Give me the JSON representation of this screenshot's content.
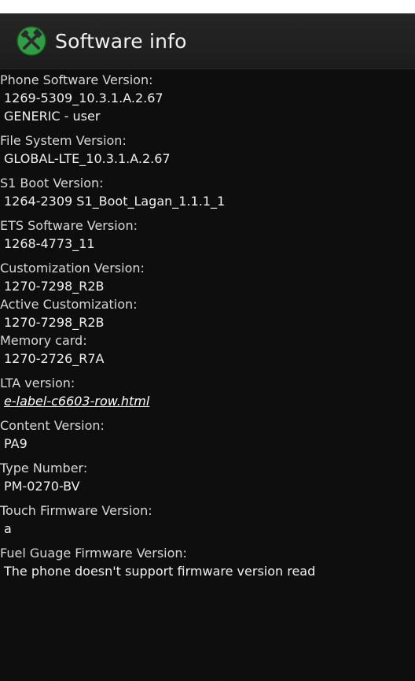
{
  "header": {
    "title": "Software info",
    "icon": "tools-icon",
    "accent_color": "#37b24d"
  },
  "items": [
    {
      "label": "Phone Software Version:",
      "values": [
        "1269-5309_10.3.1.A.2.67",
        "GENERIC - user"
      ]
    },
    {
      "label": "File System Version:",
      "values": [
        "GLOBAL-LTE_10.3.1.A.2.67"
      ]
    },
    {
      "label": "S1 Boot Version:",
      "values": [
        "1264-2309 S1_Boot_Lagan_1.1.1_1"
      ]
    },
    {
      "label": "ETS Software Version:",
      "values": [
        "1268-4773_11"
      ]
    },
    {
      "label": "Customization Version:",
      "values": [
        "1270-7298_R2B"
      ]
    },
    {
      "label": "Active Customization:",
      "values": [
        "1270-7298_R2B"
      ]
    },
    {
      "label": "Memory card:",
      "values": [
        "1270-2726_R7A"
      ]
    },
    {
      "label": "LTA version:",
      "values": [
        "e-label-c6603-row.html"
      ]
    },
    {
      "label": "Content Version:",
      "values": [
        "PA9"
      ]
    },
    {
      "label": "Type Number:",
      "values": [
        "PM-0270-BV"
      ]
    },
    {
      "label": "Touch Firmware Version:",
      "values": [
        "a"
      ]
    },
    {
      "label": "Fuel Guage Firmware Version:",
      "values": [
        "The phone doesn't support firmware version read"
      ]
    }
  ]
}
